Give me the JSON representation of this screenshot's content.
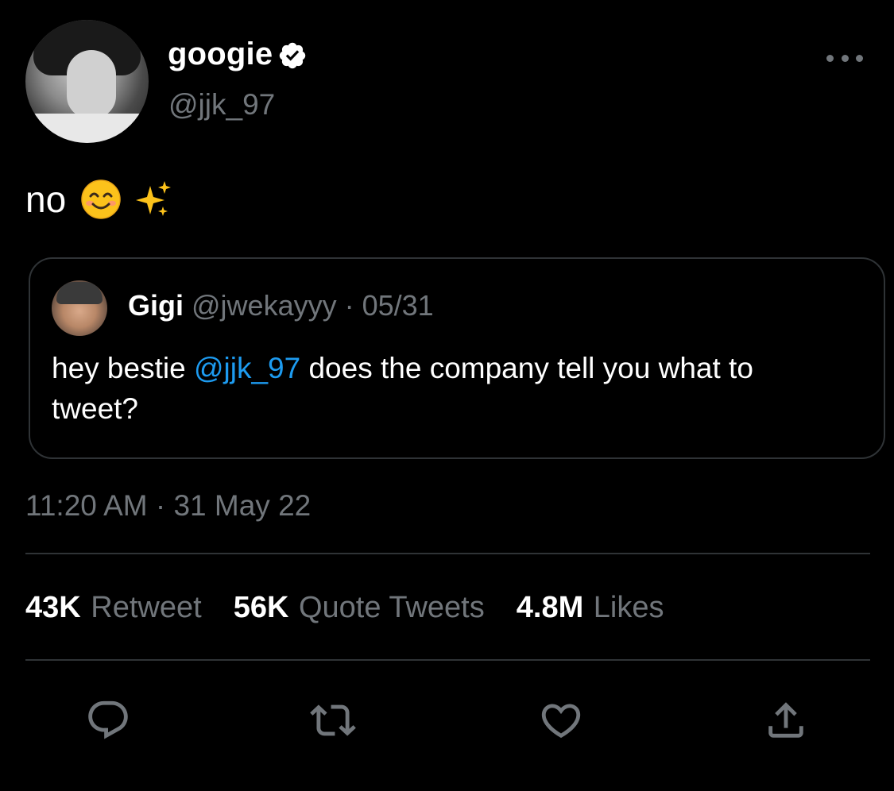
{
  "author": {
    "display_name": "googie",
    "handle": "@jjk_97",
    "verified_icon": "verified-badge-icon"
  },
  "tweet": {
    "text": "no",
    "emojis": [
      "smiling-face-icon",
      "sparkles-icon"
    ]
  },
  "quoted_tweet": {
    "name": "Gigi",
    "handle": "@jwekayyy",
    "separator": " · ",
    "date": "05/31",
    "text_before": "hey bestie ",
    "mention": "@jjk_97",
    "text_after": " does the company tell you what to tweet?"
  },
  "timestamp": "11:20 AM · 31 May 22",
  "stats": {
    "retweets": {
      "count": "43K",
      "label": "Retweet"
    },
    "quotes": {
      "count": "56K",
      "label": "Quote Tweets"
    },
    "likes": {
      "count": "4.8M",
      "label": "Likes"
    }
  },
  "actions": [
    "reply-icon",
    "retweet-icon",
    "like-icon",
    "share-icon"
  ],
  "colors": {
    "background": "#000000",
    "primary_text": "#ffffff",
    "secondary_text": "#71767b",
    "link": "#1d9bf0",
    "border": "#2f3336"
  }
}
